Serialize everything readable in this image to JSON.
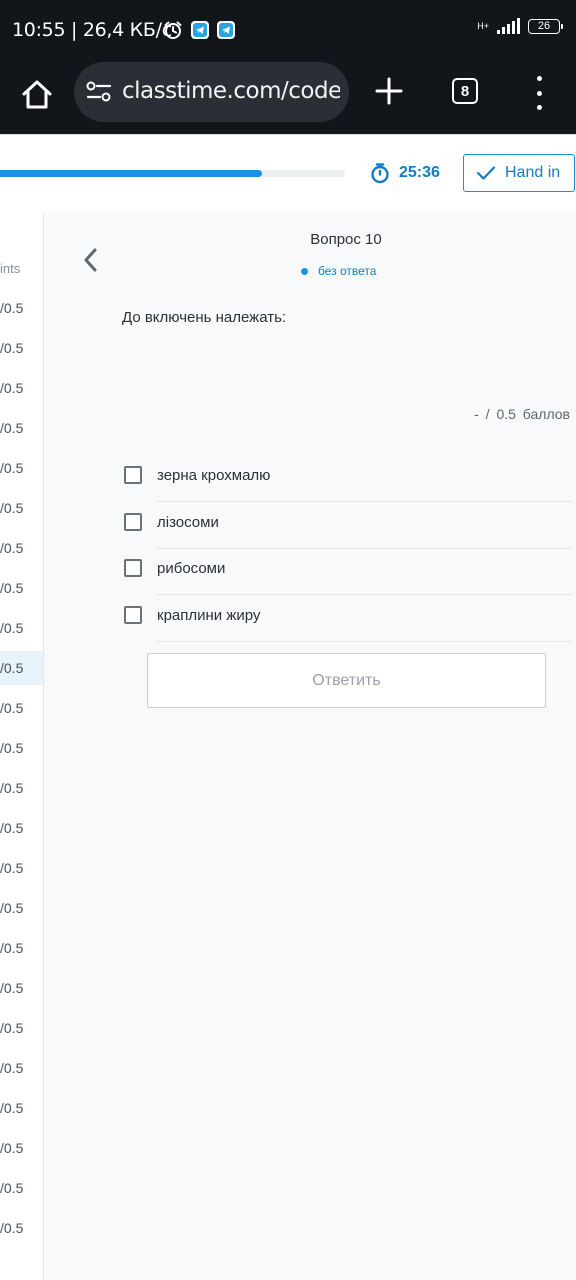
{
  "status_bar": {
    "time_and_speed": "10:55 | 26,4 КБ/с",
    "network": "H+",
    "battery": "26"
  },
  "browser": {
    "url": "classtime.com/code/",
    "tab_count": "8"
  },
  "header": {
    "progress_percent": 76,
    "timer": "25:36",
    "hand_in_label": "Hand in",
    "accent_color": "#1a8fe3"
  },
  "sidebar": {
    "header": "ints",
    "rows": [
      "/0.5",
      "/0.5",
      "/0.5",
      "/0.5",
      "/0.5",
      "/0.5",
      "/0.5",
      "/0.5",
      "/0.5",
      "/0.5",
      "/0.5",
      "/0.5",
      "/0.5",
      "/0.5",
      "/0.5",
      "/0.5",
      "/0.5",
      "/0.5",
      "/0.5",
      "/0.5",
      "/0.5",
      "/0.5",
      "/0.5",
      "/0.5"
    ],
    "active_index": 9
  },
  "question": {
    "title": "Вопрос 10",
    "status": "без ответа",
    "text": "До включень належать:",
    "score": "- / 0.5 баллов",
    "options": [
      "зерна крохмалю",
      "лізосоми",
      "рибосоми",
      "краплини жиру"
    ],
    "answer_button": "Ответить"
  }
}
